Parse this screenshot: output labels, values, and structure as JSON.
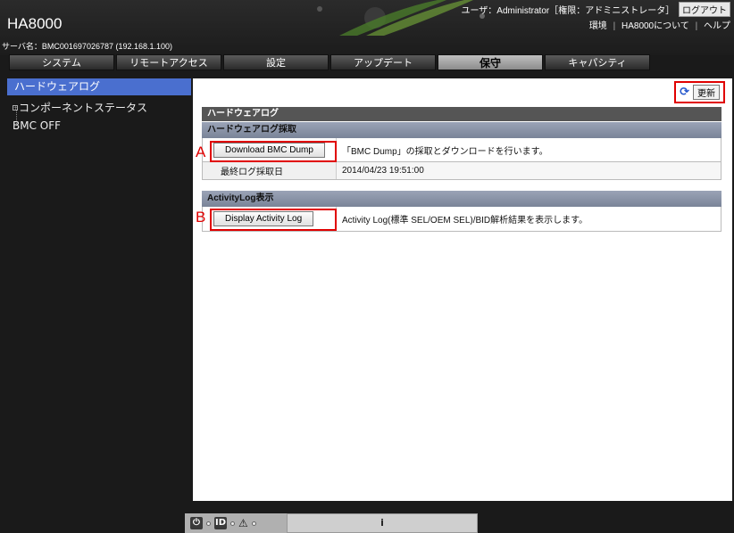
{
  "header": {
    "brand": "HA8000",
    "server_name": "サーバ名：BMC001697026787 (192.168.1.100)",
    "user_text": "ユーザ：Administrator［権限：アドミニストレータ］",
    "logout_label": "ログアウト",
    "links": [
      "環境",
      "HA8000について",
      "ヘルプ"
    ]
  },
  "tabs": [
    "システム",
    "リモートアクセス",
    "設定",
    "アップデート",
    "保守",
    "キャパシティ"
  ],
  "active_tab": "保守",
  "sidebar": {
    "selected": "ハードウェアログ",
    "items": [
      "コンポーネントステータス",
      "BMC OFF"
    ]
  },
  "toolbar": {
    "refresh_label": "更新"
  },
  "panel": {
    "title": "ハードウェアログ",
    "section1_title": "ハードウェアログ採取",
    "download_button": "Download BMC Dump",
    "download_desc": "「BMC Dump」の採取とダウンロードを行います。",
    "last_log_label": "最終ログ採取日",
    "last_log_value": "2014/04/23 19:51:00",
    "section2_title": "ActivityLog表示",
    "activity_button": "Display Activity Log",
    "activity_desc": "Activity Log(標準 SEL/OEM SEL)/BID解析結果を表示します。"
  },
  "annotations": {
    "a": "A",
    "b": "B"
  },
  "footer": {
    "id_label": "ID",
    "info_label": "i"
  },
  "colors": {
    "highlight": "#e00000",
    "selection": "#4a6fcf",
    "section": "#8a93a6"
  }
}
